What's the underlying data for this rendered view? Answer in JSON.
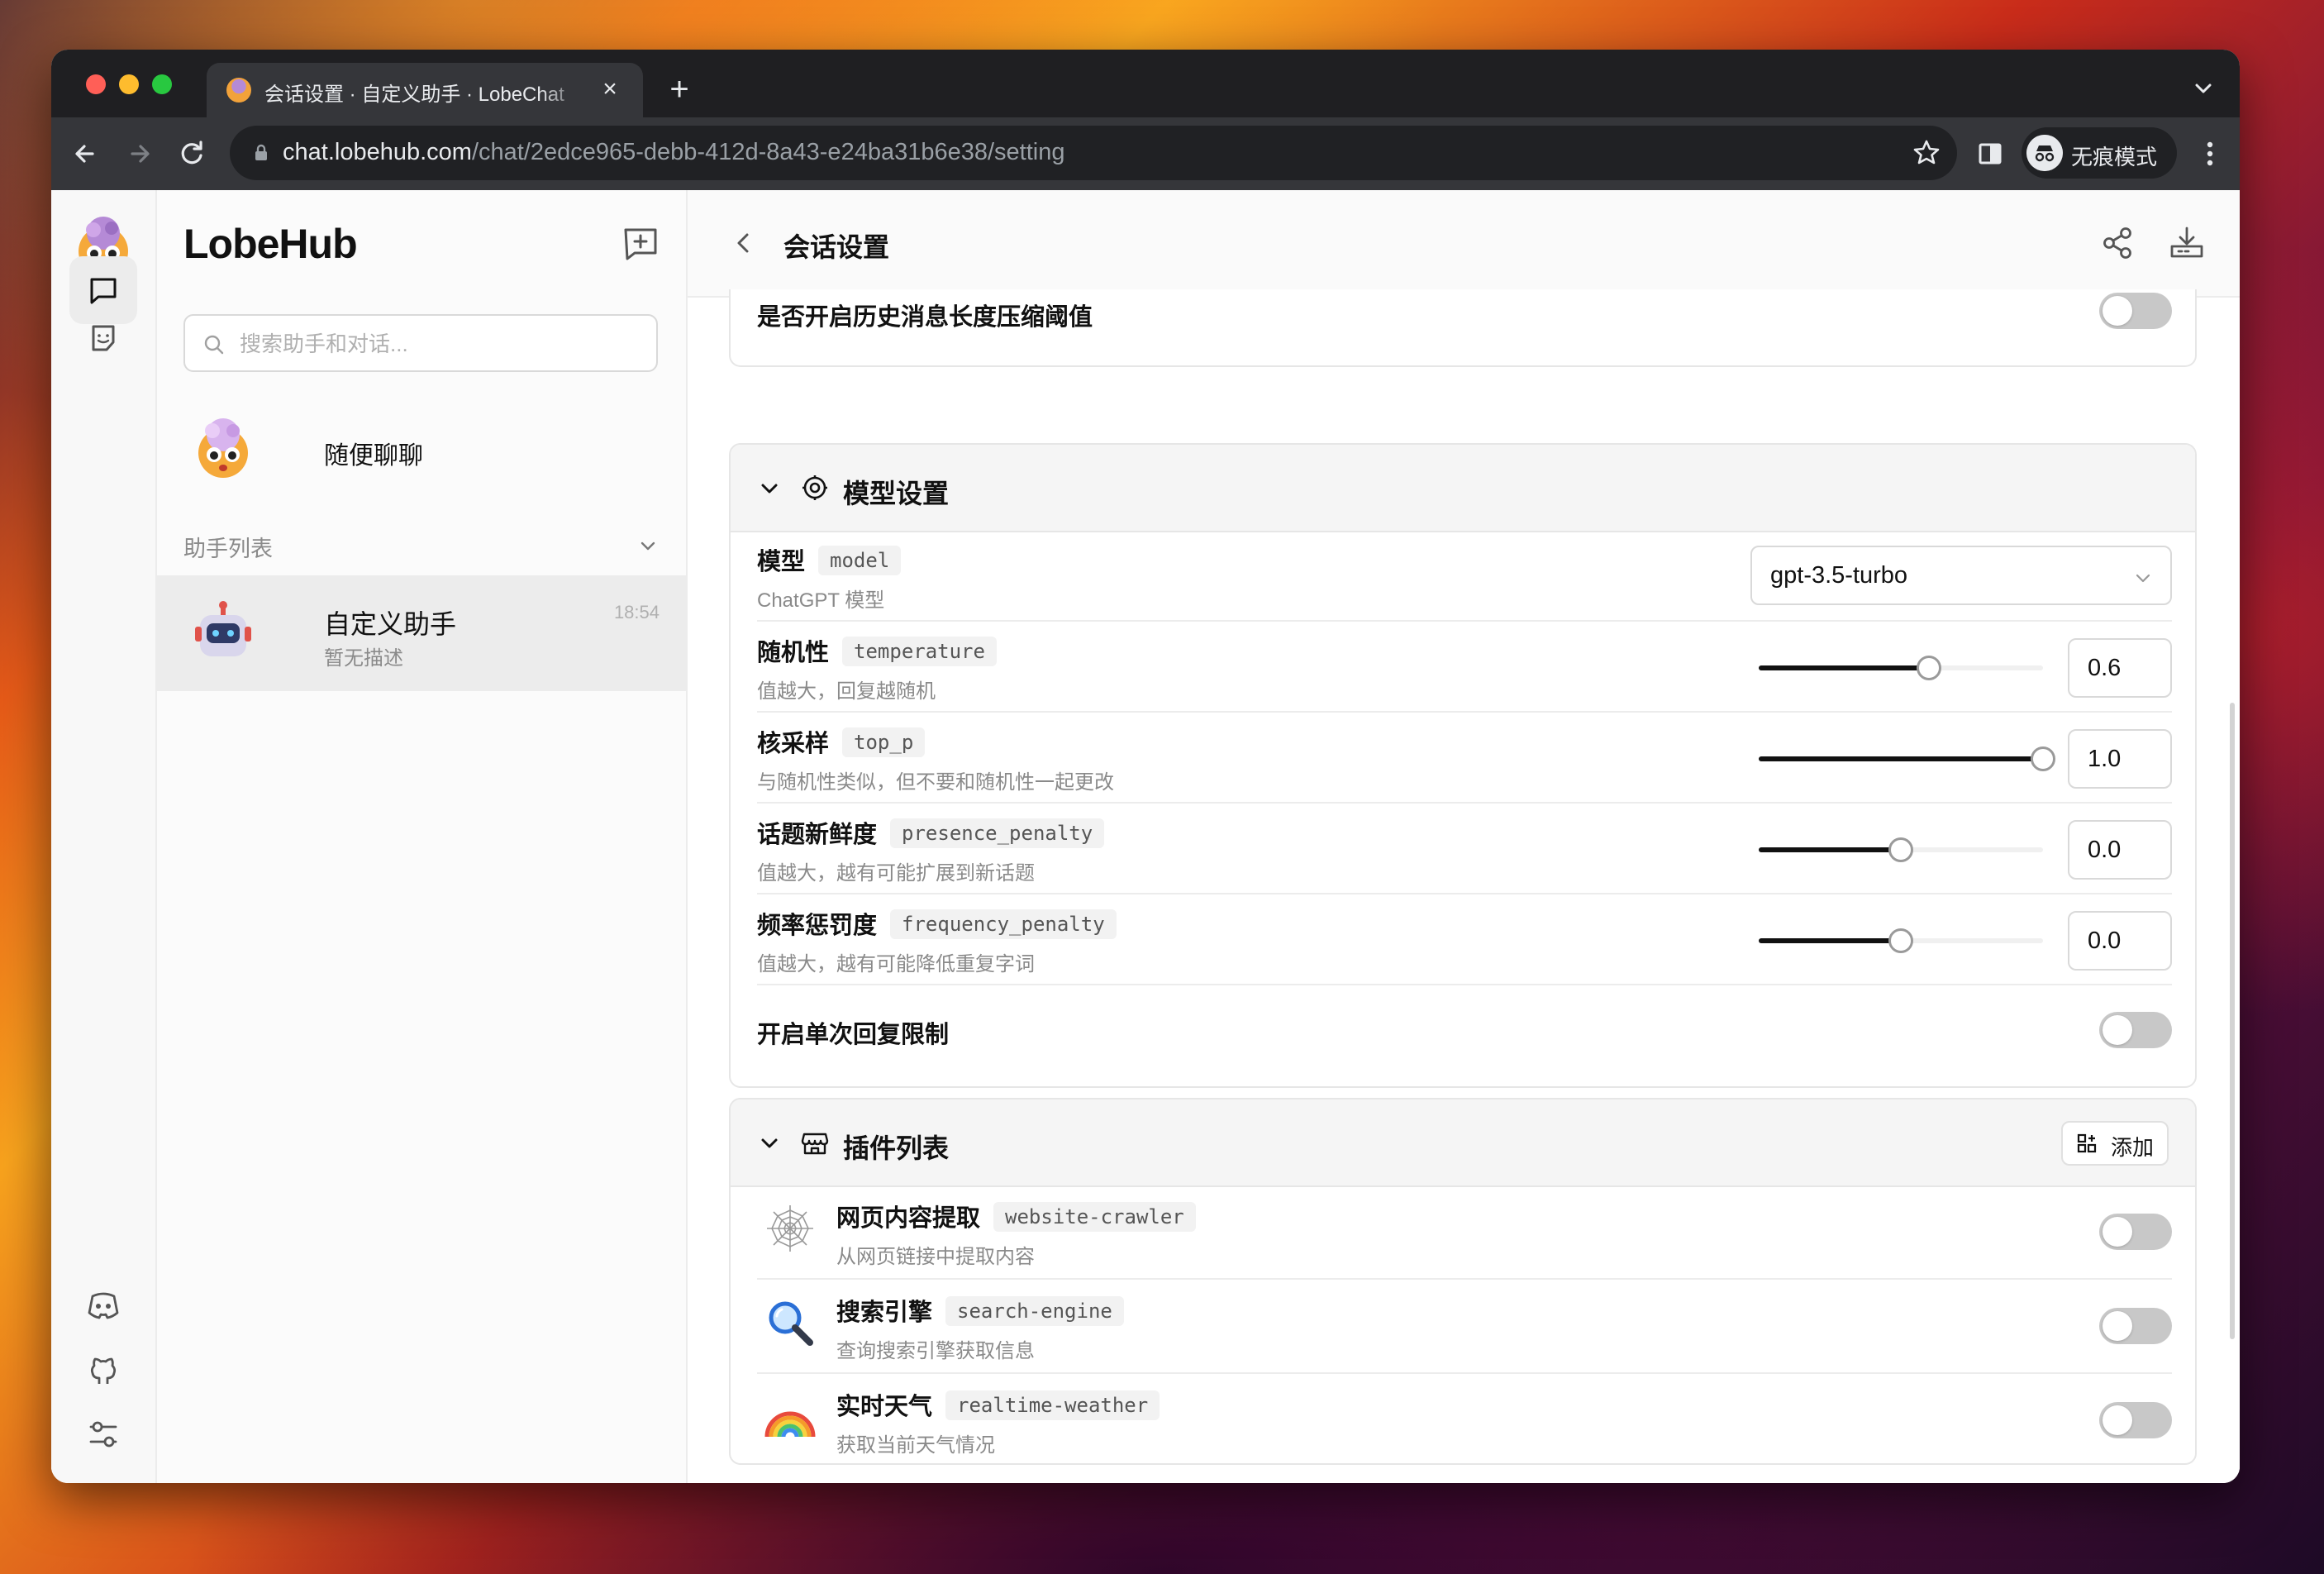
{
  "browser": {
    "tab_title": "会话设置 · 自定义助手 · LobeChat",
    "url_host": "chat.lobehub.com",
    "url_path": "/chat/2edce965-debb-412d-8a43-e24ba31b6e38/setting",
    "profile_label": "无痕模式"
  },
  "rail": {
    "items": [
      "chat",
      "market"
    ],
    "active": "chat",
    "bottom": [
      "discord",
      "github",
      "settings"
    ]
  },
  "sidebar": {
    "brand": "LobeHub",
    "search_placeholder": "搜索助手和对话...",
    "inbox_label": "随便聊聊",
    "section_title": "助手列表",
    "session": {
      "title": "自定义助手",
      "description": "暂无描述",
      "time": "18:54"
    }
  },
  "header": {
    "title": "会话设置"
  },
  "history_row": {
    "title": "是否开启历史消息长度压缩阈值",
    "enabled": false
  },
  "model_card": {
    "title": "模型设置",
    "model": {
      "title": "模型",
      "tag": "model",
      "desc": "ChatGPT 模型",
      "value": "gpt-3.5-turbo"
    },
    "params": [
      {
        "title": "随机性",
        "tag": "temperature",
        "desc": "值越大，回复越随机",
        "value": "0.6",
        "level": 0.6
      },
      {
        "title": "核采样",
        "tag": "top_p",
        "desc": "与随机性类似，但不要和随机性一起更改",
        "value": "1.0",
        "level": 1.0
      },
      {
        "title": "话题新鲜度",
        "tag": "presence_penalty",
        "desc": "值越大，越有可能扩展到新话题",
        "value": "0.0",
        "level": 0.5
      },
      {
        "title": "频率惩罚度",
        "tag": "frequency_penalty",
        "desc": "值越大，越有可能降低重复字词",
        "value": "0.0",
        "level": 0.5
      }
    ],
    "max_tokens_toggle": {
      "title": "开启单次回复限制",
      "enabled": false
    }
  },
  "plugin_card": {
    "title": "插件列表",
    "add_label": "添加",
    "plugins": [
      {
        "title": "网页内容提取",
        "tag": "website-crawler",
        "desc": "从网页链接中提取内容",
        "icon": "spider-web-icon",
        "enabled": false
      },
      {
        "title": "搜索引擎",
        "tag": "search-engine",
        "desc": "查询搜索引擎获取信息",
        "icon": "magnifier-icon",
        "enabled": false
      },
      {
        "title": "实时天气",
        "tag": "realtime-weather",
        "desc": "获取当前天气情况",
        "icon": "rainbow-icon",
        "enabled": false
      }
    ]
  }
}
